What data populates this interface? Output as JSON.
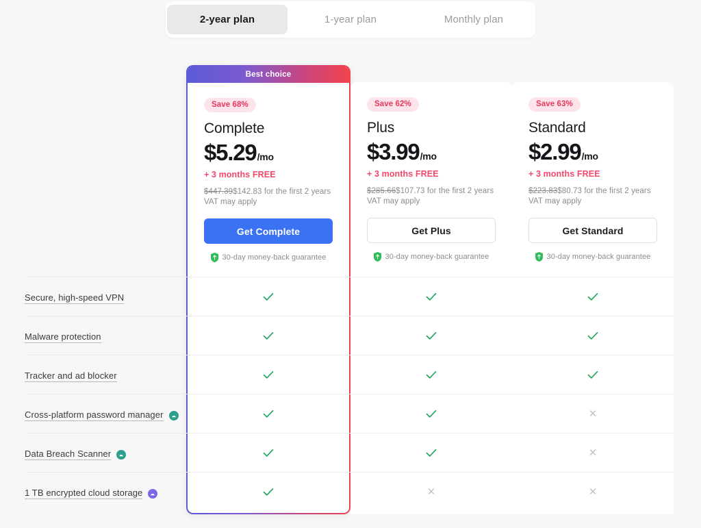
{
  "toggle": {
    "tabs": [
      {
        "label": "2-year plan",
        "active": true
      },
      {
        "label": "1-year plan",
        "active": false
      },
      {
        "label": "Monthly plan",
        "active": false
      }
    ]
  },
  "featured_banner": "Best choice",
  "plans": [
    {
      "id": "complete",
      "save_badge": "Save 68%",
      "name": "Complete",
      "price": "$5.29",
      "price_period": "/mo",
      "free_months": "+ 3 months FREE",
      "old_price": "$447.39",
      "new_price": "$142.83",
      "total_suffix": " for the first 2 years",
      "vat": "VAT may apply",
      "cta": "Get Complete",
      "guarantee": "30-day money-back guarantee",
      "featured": true
    },
    {
      "id": "plus",
      "save_badge": "Save 62%",
      "name": "Plus",
      "price": "$3.99",
      "price_period": "/mo",
      "free_months": "+ 3 months FREE",
      "old_price": "$285.66",
      "new_price": "$107.73",
      "total_suffix": " for the first 2 years",
      "vat": "VAT may apply",
      "cta": "Get Plus",
      "guarantee": "30-day money-back guarantee",
      "featured": false
    },
    {
      "id": "standard",
      "save_badge": "Save 63%",
      "name": "Standard",
      "price": "$2.99",
      "price_period": "/mo",
      "free_months": "+ 3 months FREE",
      "old_price": "$223.83",
      "new_price": "$80.73",
      "total_suffix": " for the first 2 years",
      "vat": "VAT may apply",
      "cta": "Get Standard",
      "guarantee": "30-day money-back guarantee",
      "featured": false
    }
  ],
  "features": [
    {
      "label": "Secure, high-speed VPN",
      "info_icon": null,
      "complete": "check",
      "plus": "check",
      "standard": "check"
    },
    {
      "label": "Malware protection",
      "info_icon": null,
      "complete": "check",
      "plus": "check",
      "standard": "check"
    },
    {
      "label": "Tracker and ad blocker",
      "info_icon": null,
      "complete": "check",
      "plus": "check",
      "standard": "check"
    },
    {
      "label": "Cross-platform password manager",
      "info_icon": "teal-badge-icon",
      "complete": "check",
      "plus": "check",
      "standard": "cross"
    },
    {
      "label": "Data Breach Scanner",
      "info_icon": "teal-badge-icon",
      "complete": "check",
      "plus": "check",
      "standard": "cross"
    },
    {
      "label": "1 TB encrypted cloud storage",
      "info_icon": "purple-badge-icon",
      "complete": "check",
      "plus": "cross",
      "standard": "cross"
    }
  ],
  "colors": {
    "page_bg": "#f7f7f7",
    "accent_blue": "#3b71f3",
    "accent_pink": "#f2476a",
    "check_green": "#22a75d",
    "cross_gray": "#c4c4c8",
    "gradient_start": "#5b5bd6",
    "gradient_end": "#f0444f",
    "teal_badge": "#2e9e8f",
    "purple_badge": "#7b68e8",
    "shield_green": "#2fbd5a"
  }
}
